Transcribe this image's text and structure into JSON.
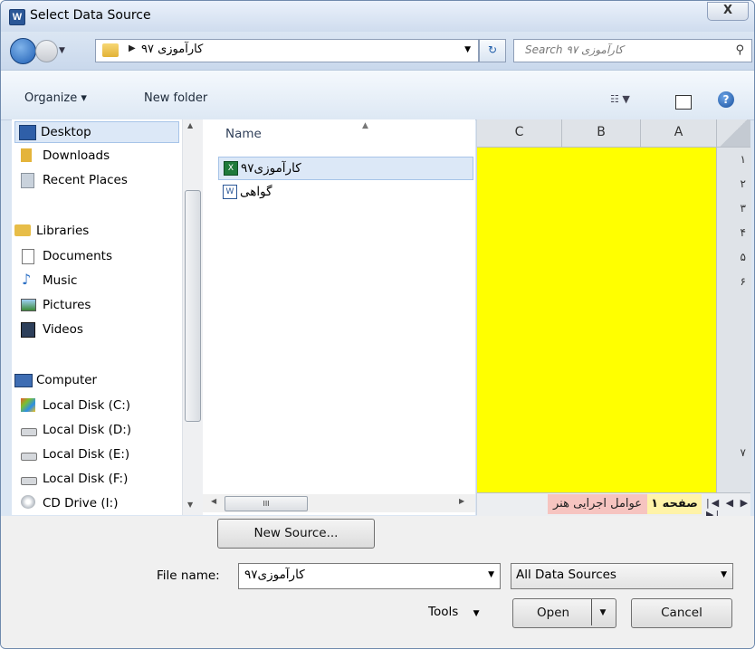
{
  "window": {
    "title": "Select Data Source",
    "close_label": "X"
  },
  "nav": {
    "address": "کارآموزی ۹۷",
    "search_placeholder": "Search کارآموزی ۹۷"
  },
  "toolbar": {
    "organize": "Organize ▾",
    "new_folder": "New folder"
  },
  "sidebar": {
    "favorites": [
      "Desktop",
      "Downloads",
      "Recent Places"
    ],
    "libraries_title": "Libraries",
    "libraries": [
      "Documents",
      "Music",
      "Pictures",
      "Videos"
    ],
    "computer_title": "Computer",
    "drives": [
      "Local Disk (C:)",
      "Local Disk (D:)",
      "Local Disk (E:)",
      "Local Disk (F:)",
      "CD Drive (I:)"
    ]
  },
  "file_list": {
    "column": "Name",
    "files": [
      {
        "name": "کارآموزی۹۷",
        "type": "excel"
      },
      {
        "name": "گواهی",
        "type": "word"
      }
    ]
  },
  "preview": {
    "columns": [
      "C",
      "B",
      "A"
    ],
    "rows": [
      "۱",
      "۲",
      "۳",
      "۴",
      "۵",
      "۶",
      "۷"
    ],
    "tabs": [
      "عوامل اجرایی هنر",
      "صفحه ۱"
    ],
    "tab_nav": "|◀ ◀ ▶ ▶|",
    "fill_color": "#ffff00"
  },
  "hscroll_grip": "III",
  "bottom": {
    "new_source": "New Source...",
    "file_name_label": "File name:",
    "file_name_value": "کارآموزی۹۷",
    "file_type": "All Data Sources",
    "tools": "Tools",
    "open": "Open",
    "cancel": "Cancel"
  }
}
